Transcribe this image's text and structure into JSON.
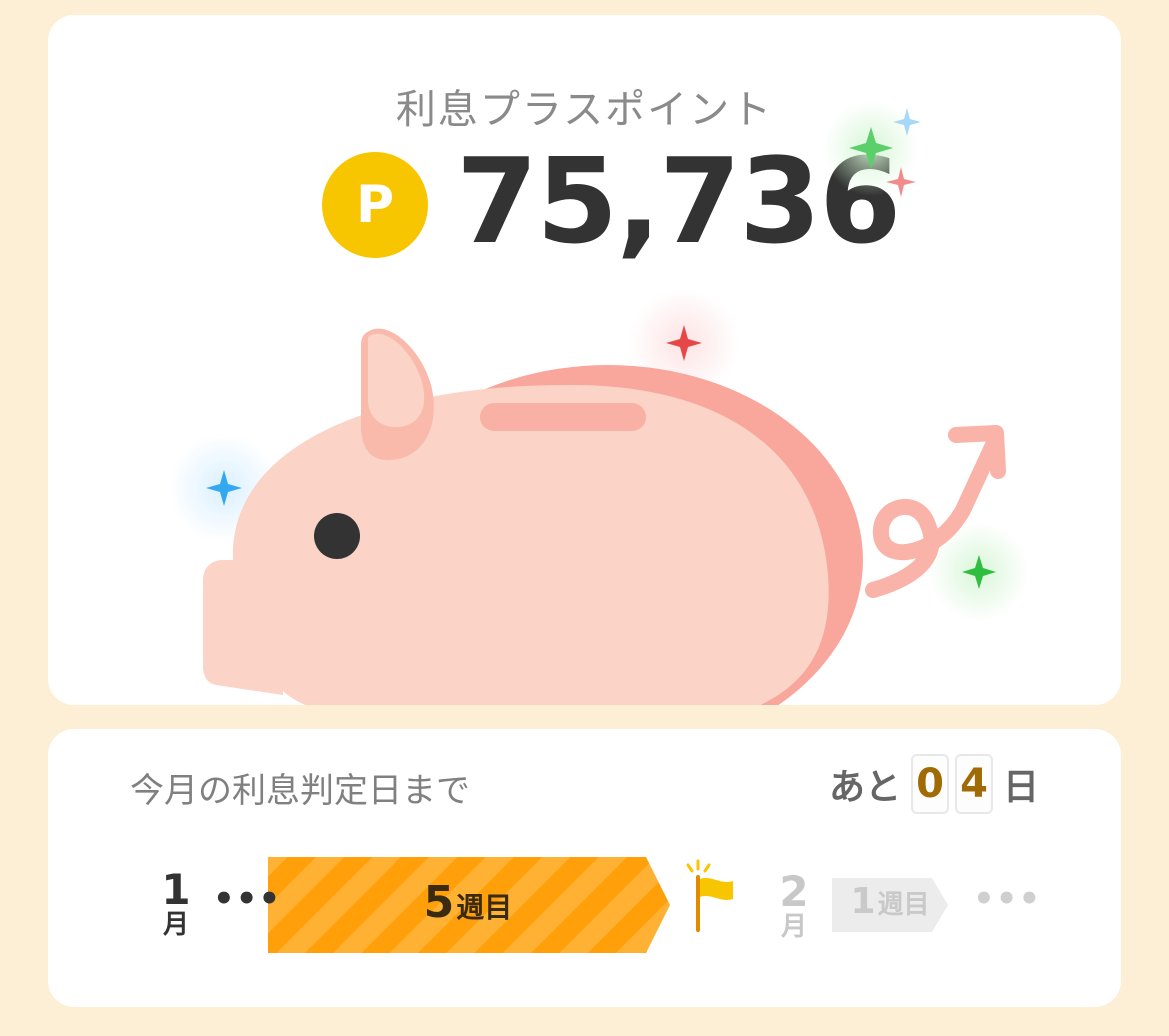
{
  "points": {
    "title": "利息プラスポイント",
    "coin_label": "P",
    "value": "75,736"
  },
  "countdown": {
    "label": "今月の利息判定日まで",
    "prefix": "あと",
    "digits": [
      "0",
      "4"
    ],
    "suffix": "日"
  },
  "timeline": {
    "current_month": {
      "number": "1",
      "unit": "月"
    },
    "current_week": {
      "number": "5",
      "unit": "週目"
    },
    "next_month": {
      "number": "2",
      "unit": "月"
    },
    "next_week": {
      "number": "1",
      "unit": "週目"
    },
    "ellipsis": "•••"
  },
  "colors": {
    "background": "#fdeed6",
    "coin": "#f7c600",
    "pig_body": "#fbd3c7",
    "pig_shade": "#f9a79d",
    "progress_orange": "#ff9f0a",
    "digit_color": "#a06b05"
  },
  "icons": [
    "coin-p-icon",
    "piggy-bank-illustration",
    "sparkle-icon",
    "flag-icon"
  ]
}
